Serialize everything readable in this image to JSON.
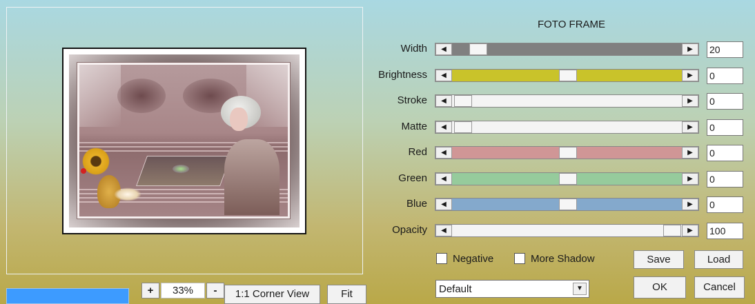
{
  "title": "FOTO FRAME",
  "sliders": [
    {
      "label": "Width",
      "value": "20",
      "fill": "#808080",
      "pos": 0.08,
      "trackColor": "#7f7f7f",
      "leftColor": "#808080"
    },
    {
      "label": "Brightness",
      "value": "0",
      "fill": "#c9c32a",
      "pos": 0.5,
      "trackColor": "#cbc62c"
    },
    {
      "label": "Stroke",
      "value": "0",
      "fill": "#f4f4f4",
      "pos": 0.01,
      "trackColor": "#f3f3f3"
    },
    {
      "label": "Matte",
      "value": "0",
      "fill": "#f4f4f4",
      "pos": 0.01,
      "trackColor": "#f3f3f3"
    },
    {
      "label": "Red",
      "value": "0",
      "fill": "#d09696",
      "pos": 0.5,
      "trackColor": "#cf9595"
    },
    {
      "label": "Green",
      "value": "0",
      "fill": "#96cb9c",
      "pos": 0.5,
      "trackColor": "#95ca9b"
    },
    {
      "label": "Blue",
      "value": "0",
      "fill": "#84a9cc",
      "pos": 0.5,
      "trackColor": "#83a8cc"
    },
    {
      "label": "Opacity",
      "value": "100",
      "fill": "#f4f4f4",
      "pos": 0.99,
      "trackColor": "#f3f3f3"
    }
  ],
  "checkboxes": {
    "negative": "Negative",
    "more_shadow": "More Shadow"
  },
  "buttons": {
    "save": "Save",
    "load": "Load",
    "ok": "OK",
    "cancel": "Cancel",
    "zoom_in": "+",
    "zoom_out": "-",
    "corner_view": "1:1 Corner View",
    "fit": "Fit"
  },
  "zoom": "33%",
  "preset": "Default",
  "icons": {
    "arrow_left": "◀",
    "arrow_right": "▶",
    "dropdown": "▼"
  }
}
